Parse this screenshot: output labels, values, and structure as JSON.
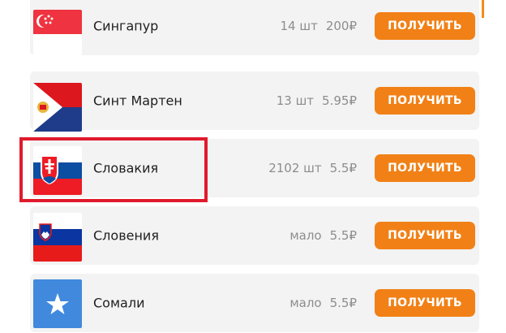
{
  "countries": [
    {
      "name": "Сингапур",
      "stock": "14 шт",
      "price": "200₽",
      "button_label": "ПОЛУЧИТЬ",
      "flag_icon": "singapore-flag-icon",
      "colors": [
        "#ef3340",
        "#ffffff"
      ]
    },
    {
      "name": "Синт Мартен",
      "stock": "13 шт",
      "price": "5.95₽",
      "button_label": "ПОЛУЧИТЬ",
      "flag_icon": "sint-maarten-flag-icon",
      "colors": [
        "#dc171d",
        "#1f3c8a",
        "#ffffff",
        "#e8b53b"
      ]
    },
    {
      "name": "Словакия",
      "stock": "2102 шт",
      "price": "5.5₽",
      "button_label": "ПОЛУЧИТЬ",
      "flag_icon": "slovakia-flag-icon",
      "colors": [
        "#ffffff",
        "#0b4ea2",
        "#ee1c25"
      ]
    },
    {
      "name": "Словения",
      "stock": "мало",
      "price": "5.5₽",
      "button_label": "ПОЛУЧИТЬ",
      "flag_icon": "slovenia-flag-icon",
      "colors": [
        "#ffffff",
        "#0b35a0",
        "#e81b1b"
      ]
    },
    {
      "name": "Сомали",
      "stock": "мало",
      "price": "5.5₽",
      "button_label": "ПОЛУЧИТЬ",
      "flag_icon": "somalia-flag-icon",
      "colors": [
        "#4189dd",
        "#ffffff"
      ]
    }
  ],
  "highlight": {
    "target": "Словакия",
    "color": "#e01b2d"
  },
  "accent": "#f18117"
}
